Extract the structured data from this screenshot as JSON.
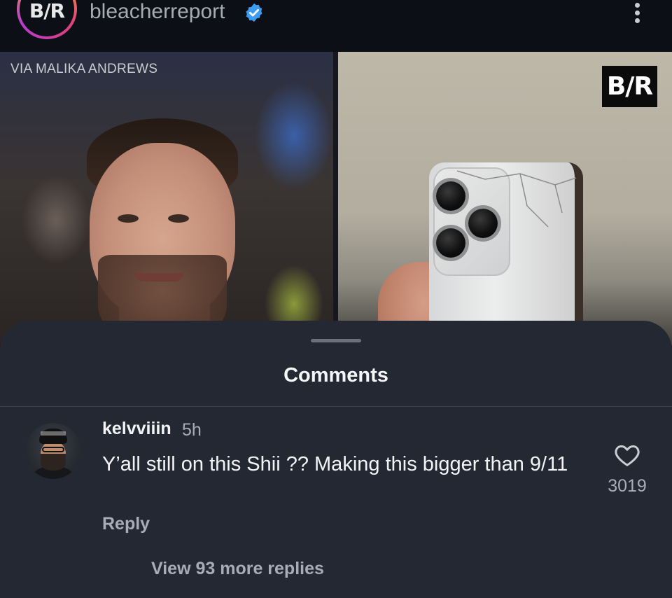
{
  "header": {
    "avatar_logo": "B/R",
    "handle": "bleacherreport",
    "verified_icon": "verified-badge-icon",
    "more_icon": "kebab-menu-icon"
  },
  "post": {
    "via_label": "VIA MALIKA ANDREWS",
    "badge_logo": "B/R"
  },
  "comments_sheet": {
    "title": "Comments",
    "comments": [
      {
        "username": "kelvviiin",
        "time": "5h",
        "text": "Y’all still on this Shii ?? Making this bigger than 9/11",
        "reply_label": "Reply",
        "like_count": "3019",
        "like_icon": "heart-icon",
        "view_replies_label": "View 93 more replies"
      }
    ]
  },
  "colors": {
    "background": "#0b0d12",
    "sheet": "#242833",
    "muted_text": "#a7acb6",
    "verified_blue": "#3d9bf0"
  }
}
